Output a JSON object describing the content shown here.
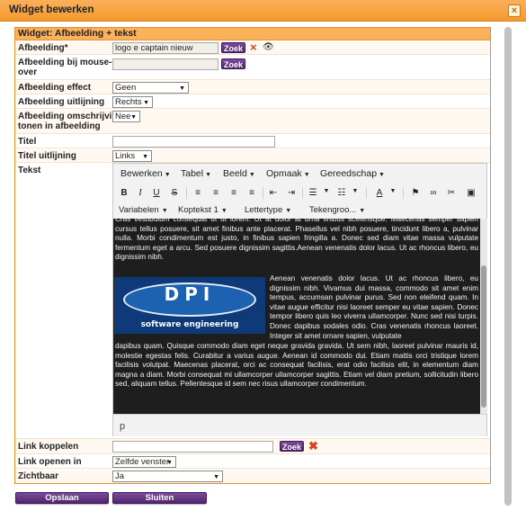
{
  "window": {
    "title": "Widget bewerken",
    "close_label": "×"
  },
  "panel": {
    "title": "Widget: Afbeelding + tekst"
  },
  "fields": {
    "afbeelding": {
      "label": "Afbeelding*",
      "value": "logo e captain nieuw",
      "zoek_label": "Zoek",
      "delete_icon": "×",
      "view_icon": "eye-icon"
    },
    "mouseover": {
      "label_line1": "Afbeelding bij mouse-",
      "label_line2": "over",
      "value": "",
      "zoek_label": "Zoek"
    },
    "effect": {
      "label": "Afbeelding effect",
      "value": "Geen"
    },
    "uitlijning": {
      "label": "Afbeelding uitlijning",
      "value": "Rechts"
    },
    "omschrijving": {
      "label_line1": "Afbeelding omschrijving",
      "label_line2": "tonen in afbeelding",
      "value": "Nee"
    },
    "titel": {
      "label": "Titel",
      "value": ""
    },
    "titel_uitlijning": {
      "label": "Titel uitlijning",
      "value": "Links"
    },
    "tekst": {
      "label": "Tekst"
    },
    "link": {
      "label": "Link koppelen",
      "value": "",
      "zoek_label": "Zoek"
    },
    "link_openen": {
      "label": "Link openen in",
      "value": "Zelfde venster"
    },
    "zichtbaar": {
      "label": "Zichtbaar",
      "value": "Ja"
    }
  },
  "editor": {
    "menus": [
      "Bewerken",
      "Tabel",
      "Beeld",
      "Opmaak",
      "Gereedschap"
    ],
    "toolbar2": [
      "Variabelen",
      "Koptekst 1",
      "Lettertype",
      "Tekengroo..."
    ],
    "content": {
      "para1": "Cras vestibulum consequat ut ut lorem. Ut at dolor at urna finibus scelerisque. Maecenas semper sapien cursus tellus posuere, sit amet finibus ante placerat. Phasellus vel nibh posuere, tincidunt libero a, pulvinar nulla. Morbi condimentum est justo, in finibus sapien fringilla a. Donec sed diam vitae massa vulputate fermentum eget a arcu. Sed posuere dignissim sagittis.Aenean venenatis dolor lacus. Ut ac rhoncus libero, eu dignissim nibh.",
      "logo_text": "DPI",
      "logo_sub": "software engineering",
      "para2": "Aenean venenatis dolor lacus. Ut ac rhoncus libero, eu dignissim nibh. Vivamus dui massa, commodo sit amet enim tempus, accumsan pulvinar purus. Sed non eleifend quam. In vitae augue efficitur nisi laoreet semper eu vitae sapien. Donec tempor libero quis leo viverra ullamcorper. Nunc sed nisi turpis. Donec dapibus sodales odio. Cras venenatis rhoncus laoreet. Integer sit amet ornare sapien, vulputate",
      "para3": "dapibus quam. Quisque commodo diam eget neque gravida gravida. Ut sem nibh, laoreet pulvinar mauris id, molestie egestas felis. Curabitur a varius augue. Aenean id commodo dui. Etiam mattis orci tristique lorem facilisis volutpat. Maecenas placerat, orci ac consequat facilisis, erat odio facilisis elit, in elementum diam magna a diam. Morbi consequat mi ullamcorper ullamcorper sagittis. Etiam vel diam pretium, sollicitudin libero sed, aliquam tellus. Pellentesque id sem nec risus ullamcorper condimentum."
    },
    "status_path": "p"
  },
  "buttons": {
    "save": "Opslaan",
    "close": "Sluiten"
  }
}
